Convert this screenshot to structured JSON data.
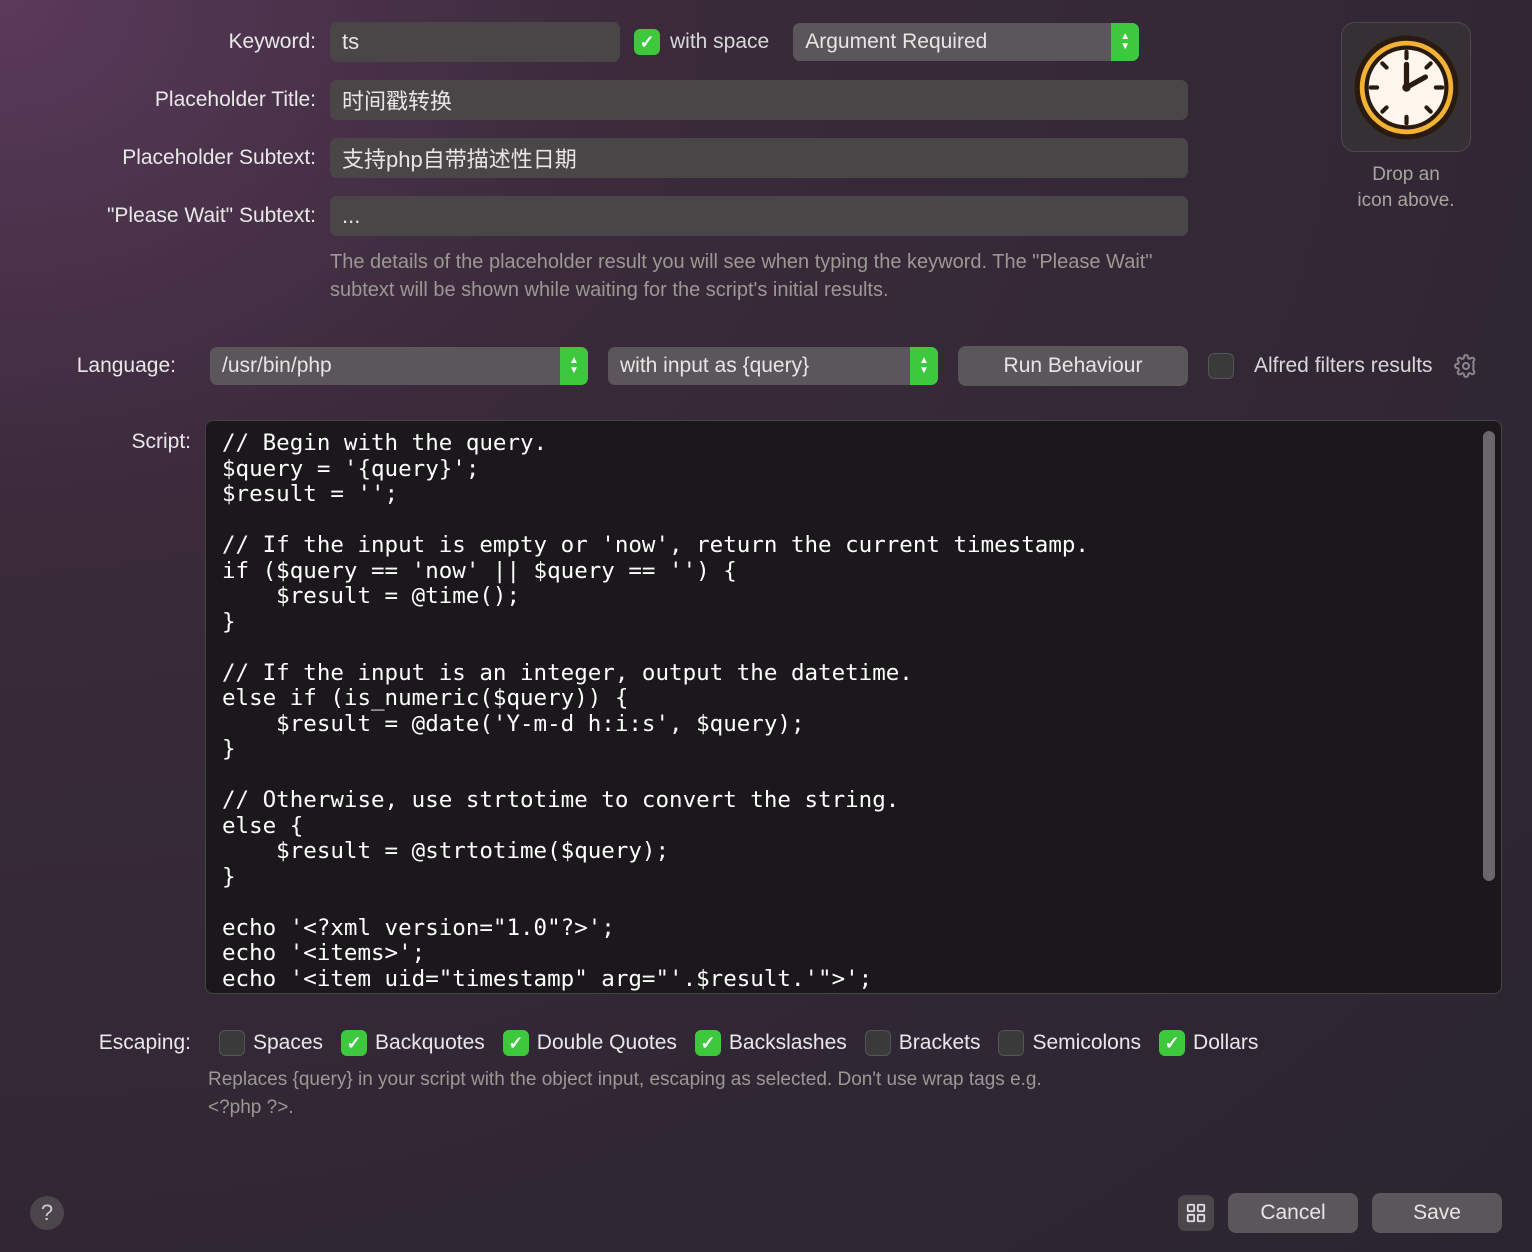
{
  "labels": {
    "keyword": "Keyword:",
    "with_space": "with space",
    "placeholder_title": "Placeholder Title:",
    "placeholder_subtext": "Placeholder Subtext:",
    "please_wait": "\"Please Wait\" Subtext:",
    "language": "Language:",
    "script": "Script:",
    "escaping": "Escaping:",
    "alfred_filters": "Alfred filters results"
  },
  "fields": {
    "keyword": "ts",
    "argument_mode": "Argument Required",
    "placeholder_title": "时间戳转换",
    "placeholder_subtext": "支持php自带描述性日期",
    "please_wait_subtext": "...",
    "language": "/usr/bin/php",
    "input_mode": "with input as {query}"
  },
  "checkboxes": {
    "with_space": true,
    "alfred_filters": false
  },
  "help": {
    "placeholder_help": "The details of the placeholder result you will see when typing the keyword. The \"Please Wait\" subtext will be shown while waiting for the script's initial results.",
    "escaping_help": "Replaces {query} in your script with the object input, escaping as selected. Don't use wrap tags e.g. <?php ?>."
  },
  "icon_well": {
    "line1": "Drop an",
    "line2": "icon above."
  },
  "buttons": {
    "run_behaviour": "Run Behaviour",
    "cancel": "Cancel",
    "save": "Save"
  },
  "script": "// Begin with the query.\n$query = '{query}';\n$result = '';\n\n// If the input is empty or 'now', return the current timestamp.\nif ($query == 'now' || $query == '') {\n    $result = @time();\n}\n\n// If the input is an integer, output the datetime.\nelse if (is_numeric($query)) {\n    $result = @date('Y-m-d h:i:s', $query);\n}\n\n// Otherwise, use strtotime to convert the string.\nelse {\n    $result = @strtotime($query);\n}\n\necho '<?xml version=\"1.0\"?>';\necho '<items>';\necho '<item uid=\"timestamp\" arg=\"'.$result.'\">';",
  "escaping": [
    {
      "label": "Spaces",
      "checked": false
    },
    {
      "label": "Backquotes",
      "checked": true
    },
    {
      "label": "Double Quotes",
      "checked": true
    },
    {
      "label": "Backslashes",
      "checked": true
    },
    {
      "label": "Brackets",
      "checked": false
    },
    {
      "label": "Semicolons",
      "checked": false
    },
    {
      "label": "Dollars",
      "checked": true
    }
  ]
}
